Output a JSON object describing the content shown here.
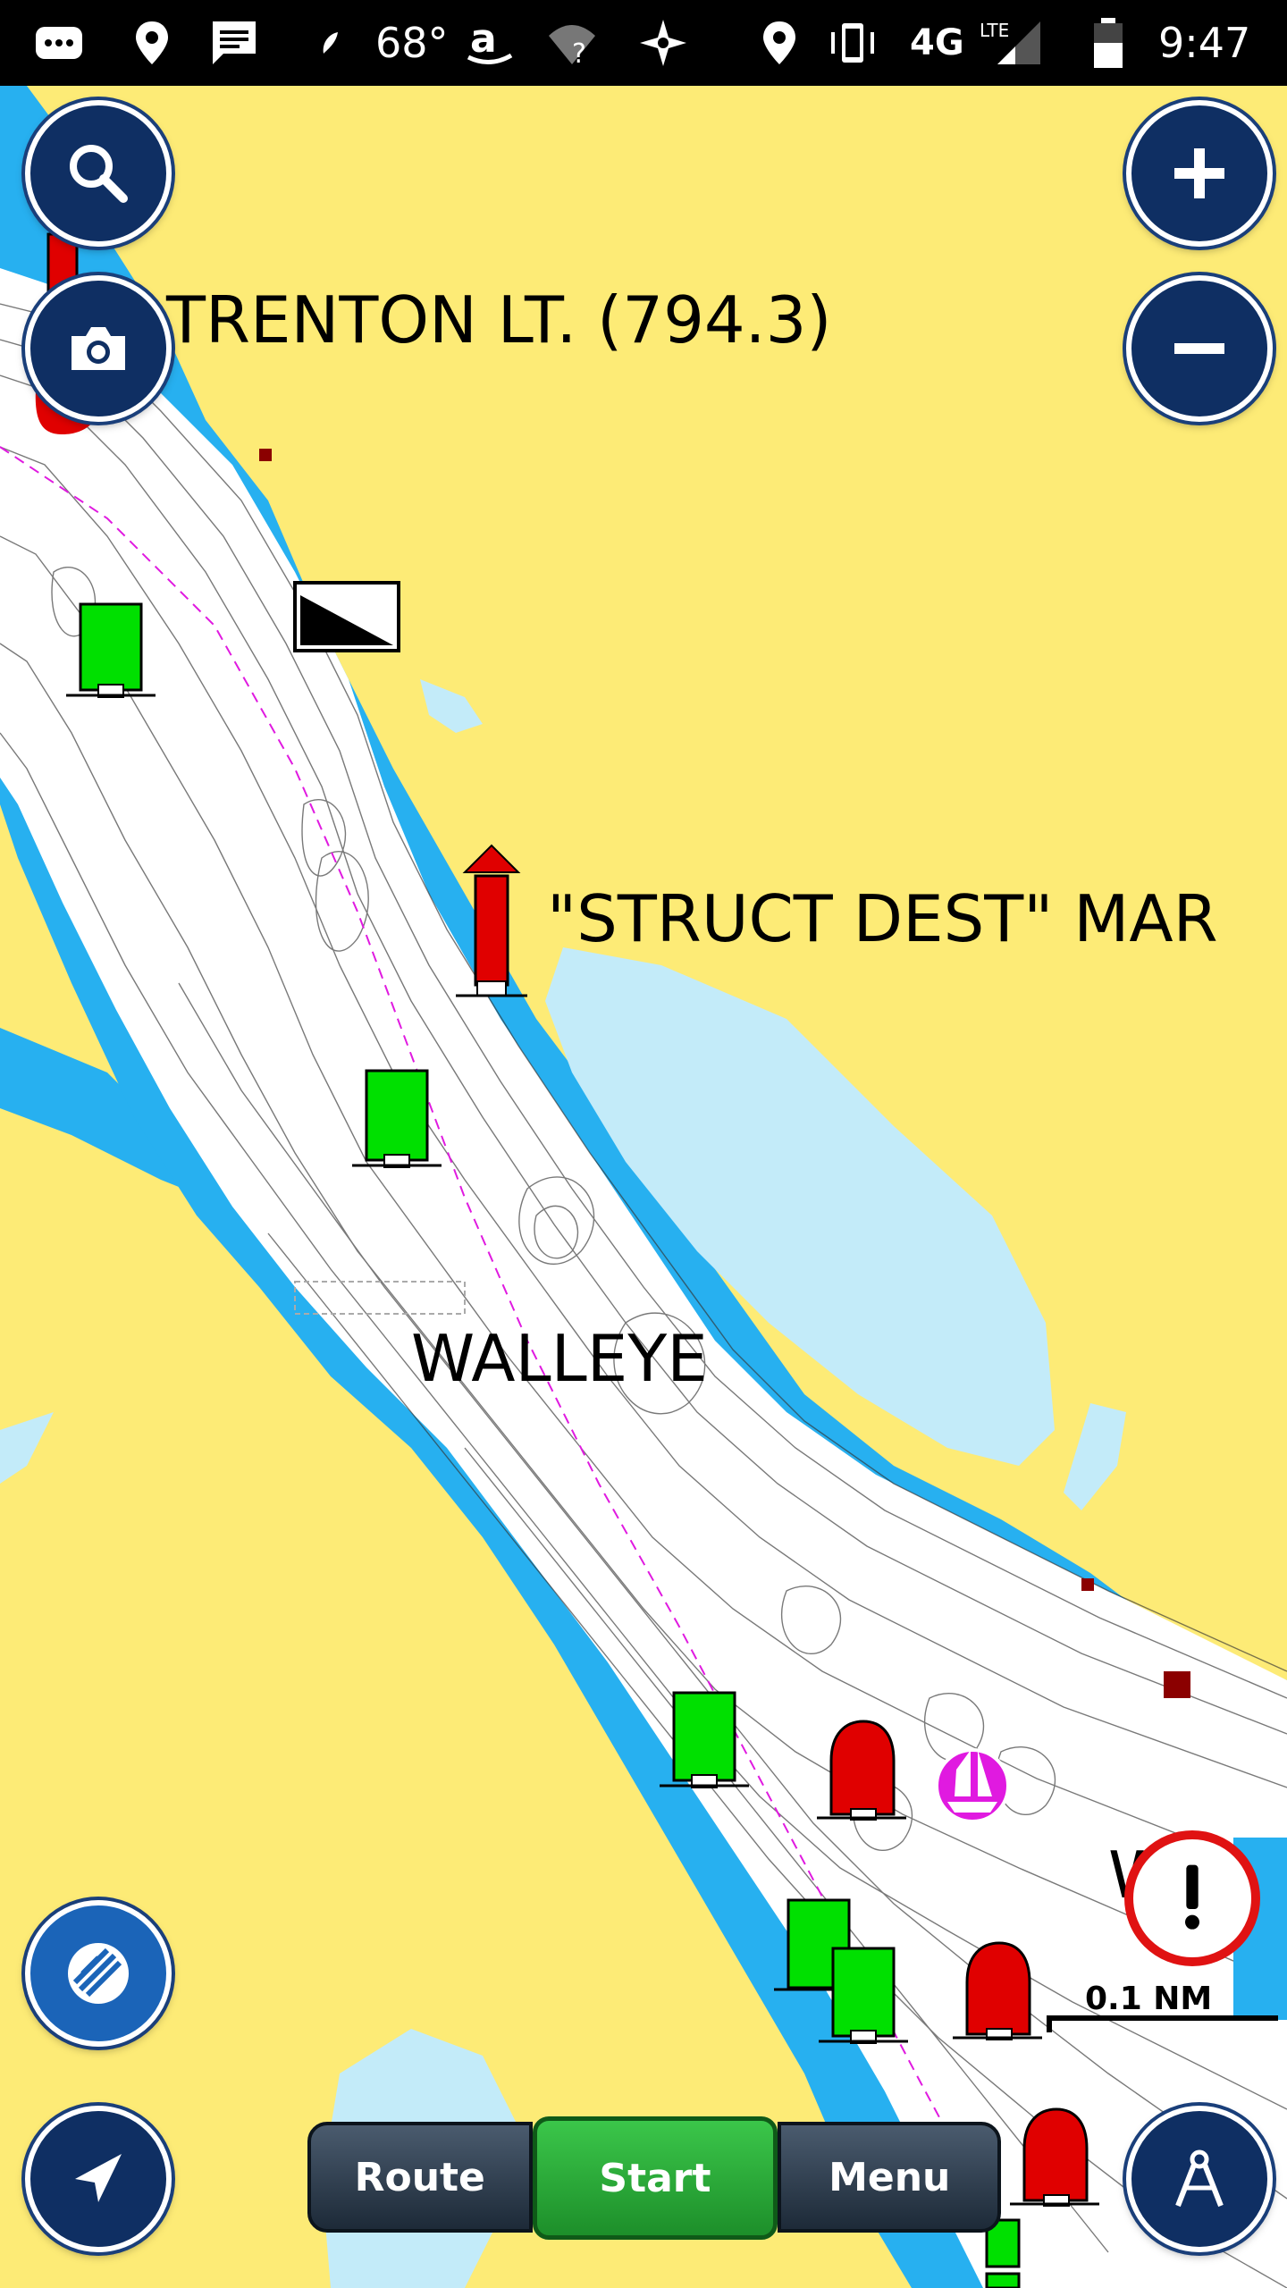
{
  "status_bar": {
    "temperature": "68°",
    "network": "4G",
    "network_sub": "LTE",
    "time": "9:47"
  },
  "map": {
    "labels": {
      "trenton": "TRENTON LT. (794.3)",
      "struct_dest": "\"STRUCT DEST\" MAR",
      "walleye": "WALLEYE",
      "partial": "W"
    },
    "scale_label": "0.1 NM"
  },
  "toolbar": {
    "route_label": "Route",
    "start_label": "Start",
    "menu_label": "Menu"
  },
  "colors": {
    "land": "#fdeb76",
    "deep_water": "#27b0f0",
    "shallow_water": "#c3ebf9",
    "channel": "#ffffff",
    "button": "#0f2f63",
    "start_green": "#2cb53a",
    "red_marker": "#e00000",
    "green_marker": "#00e000",
    "boat": "#e01ae0"
  }
}
